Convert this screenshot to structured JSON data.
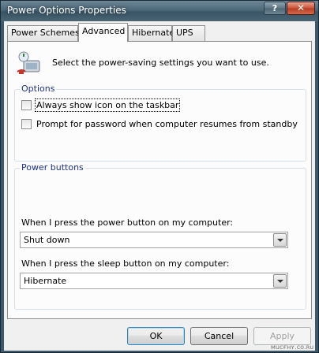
{
  "window": {
    "title": "Power Options Properties",
    "help_glyph": "?",
    "close_glyph": "✕"
  },
  "tabs": [
    {
      "label": "Power Schemes",
      "active": false
    },
    {
      "label": "Advanced",
      "active": true
    },
    {
      "label": "Hibernate",
      "active": false
    },
    {
      "label": "UPS",
      "active": false
    }
  ],
  "advanced": {
    "intro_text": "Select the power-saving settings you want to use.",
    "options_group": {
      "title": "Options",
      "always_show_icon": {
        "label": "Always show icon on the taskbar",
        "checked": false
      },
      "prompt_password": {
        "label": "Prompt for password when computer resumes from standby",
        "checked": false
      }
    },
    "power_buttons_group": {
      "title": "Power buttons",
      "power_button": {
        "label": "When I press the power button on my computer:",
        "value": "Shut down"
      },
      "sleep_button": {
        "label": "When I press the sleep button on my computer:",
        "value": "Hibernate"
      }
    }
  },
  "buttons": {
    "ok": "OK",
    "cancel": "Cancel",
    "apply": "Apply"
  },
  "watermark": "мuᴄғнʏ.ᴄᴏ.ʀᴜ",
  "colors": {
    "group_title": "#1e3287",
    "titlebar": "#4d6a7b",
    "close_button": "#c8543a"
  }
}
